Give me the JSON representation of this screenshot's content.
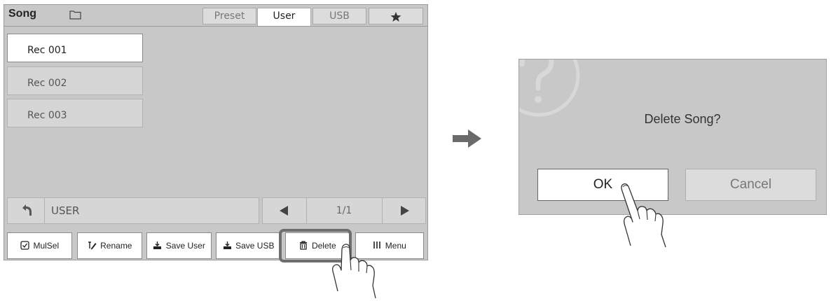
{
  "song_screen": {
    "title": "Song",
    "folder_icon": "folder-icon",
    "tabs": [
      {
        "label": "Preset",
        "active": false
      },
      {
        "label": "User",
        "active": true
      },
      {
        "label": "USB",
        "active": false
      },
      {
        "label": "★",
        "active": false,
        "icon": "star-icon"
      }
    ],
    "files": [
      {
        "name": "Rec 001",
        "selected": true
      },
      {
        "name": "Rec 002",
        "selected": false
      },
      {
        "name": "Rec 003",
        "selected": false
      }
    ],
    "path": {
      "back_icon": "back-arrow-icon",
      "label": "USER"
    },
    "pager": {
      "prev_icon": "triangle-left-icon",
      "page": "1/1",
      "next_icon": "triangle-right-icon"
    },
    "function_buttons": [
      {
        "label": "MulSel",
        "icon": "multi-select-icon"
      },
      {
        "label": "Rename",
        "icon": "rename-icon"
      },
      {
        "label": "Save User",
        "icon": "save-user-icon"
      },
      {
        "label": "Save USB",
        "icon": "save-usb-icon"
      },
      {
        "label": "Delete",
        "icon": "trash-icon"
      },
      {
        "label": "Menu",
        "icon": "menu-bars-icon"
      }
    ]
  },
  "transition_arrow_icon": "right-arrow-icon",
  "dialog": {
    "icon": "question-icon",
    "message": "Delete Song?",
    "ok_label": "OK",
    "cancel_label": "Cancel"
  },
  "colors": {
    "screen_bg": "#c8c8c8",
    "button_bg": "#ffffff",
    "highlight_border": "#6e6e6e"
  }
}
